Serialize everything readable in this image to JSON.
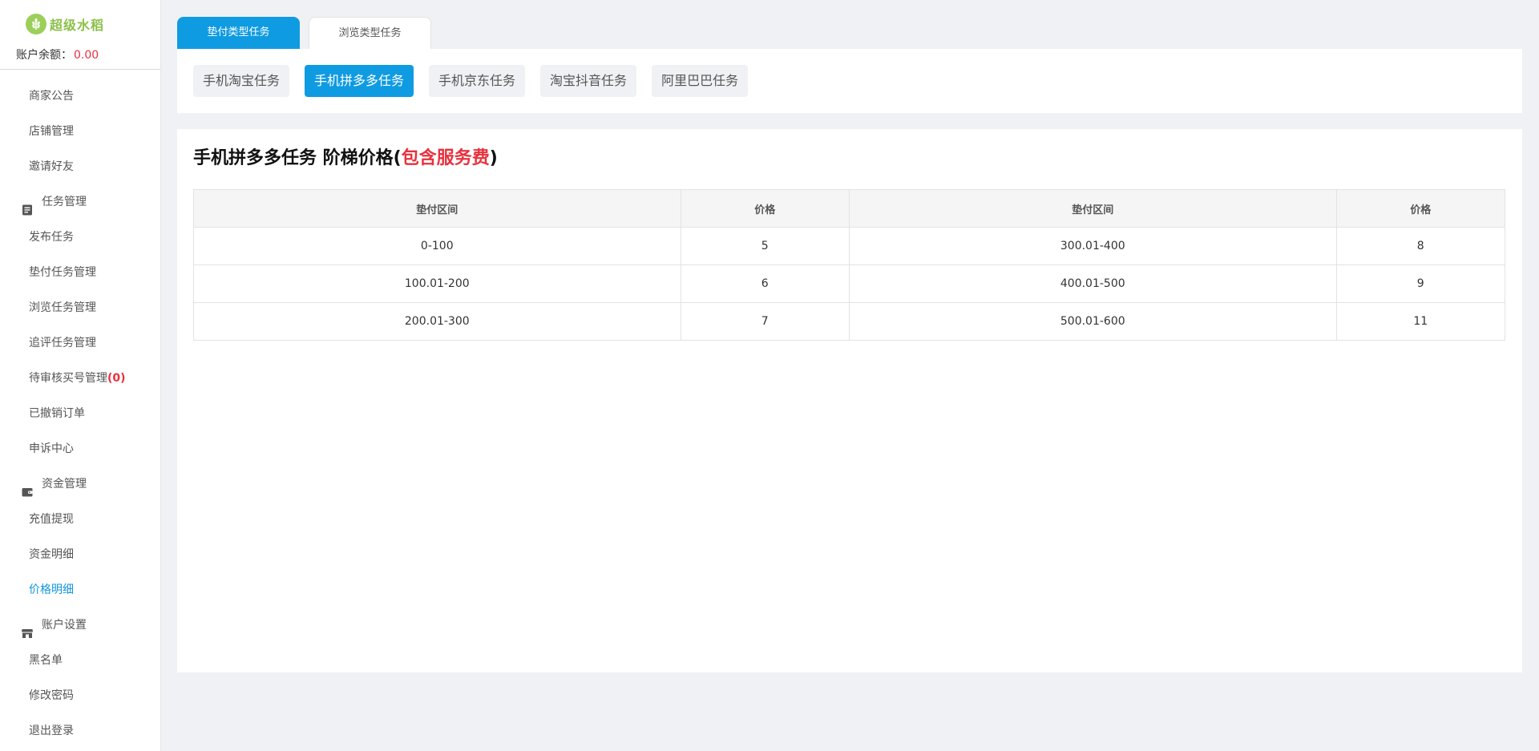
{
  "brand": {
    "name": "超级水稻"
  },
  "account": {
    "balance_label": "账户余额：",
    "balance_value": "0.00"
  },
  "menu": {
    "items_top": [
      "商家公告",
      "店铺管理",
      "邀请好友"
    ],
    "group_task": "任务管理",
    "task_items": [
      "发布任务",
      "垫付任务管理",
      "浏览任务管理",
      "追评任务管理"
    ],
    "pending_label": "待审核买号管理",
    "pending_count": "(0)",
    "task_items_after": [
      "已撤销订单",
      "申诉中心"
    ],
    "group_funds": "资金管理",
    "fund_items": [
      "充值提现",
      "资金明细",
      "价格明细"
    ],
    "group_account": "账户设置",
    "account_items": [
      "黑名单",
      "修改密码",
      "退出登录"
    ],
    "active_item": "价格明细"
  },
  "top_tabs": [
    {
      "label": "垫付类型任务",
      "active": true
    },
    {
      "label": "浏览类型任务",
      "active": false
    }
  ],
  "sub_tabs": [
    {
      "label": "手机淘宝任务",
      "active": false
    },
    {
      "label": "手机拼多多任务",
      "active": true
    },
    {
      "label": "手机京东任务",
      "active": false
    },
    {
      "label": "淘宝抖音任务",
      "active": false
    },
    {
      "label": "阿里巴巴任务",
      "active": false
    }
  ],
  "heading": {
    "main": "手机拼多多任务 阶梯价格",
    "open": "(",
    "highlight": "包含服务费",
    "close": ")"
  },
  "table": {
    "headers": [
      "垫付区间",
      "价格",
      "垫付区间",
      "价格"
    ],
    "rows": [
      [
        "0-100",
        "5",
        "300.01-400",
        "8"
      ],
      [
        "100.01-200",
        "6",
        "400.01-500",
        "9"
      ],
      [
        "200.01-300",
        "7",
        "500.01-600",
        "11"
      ]
    ]
  },
  "colors": {
    "accent": "#0f9be1",
    "danger": "#e8313d",
    "brand": "#8cc04a"
  }
}
